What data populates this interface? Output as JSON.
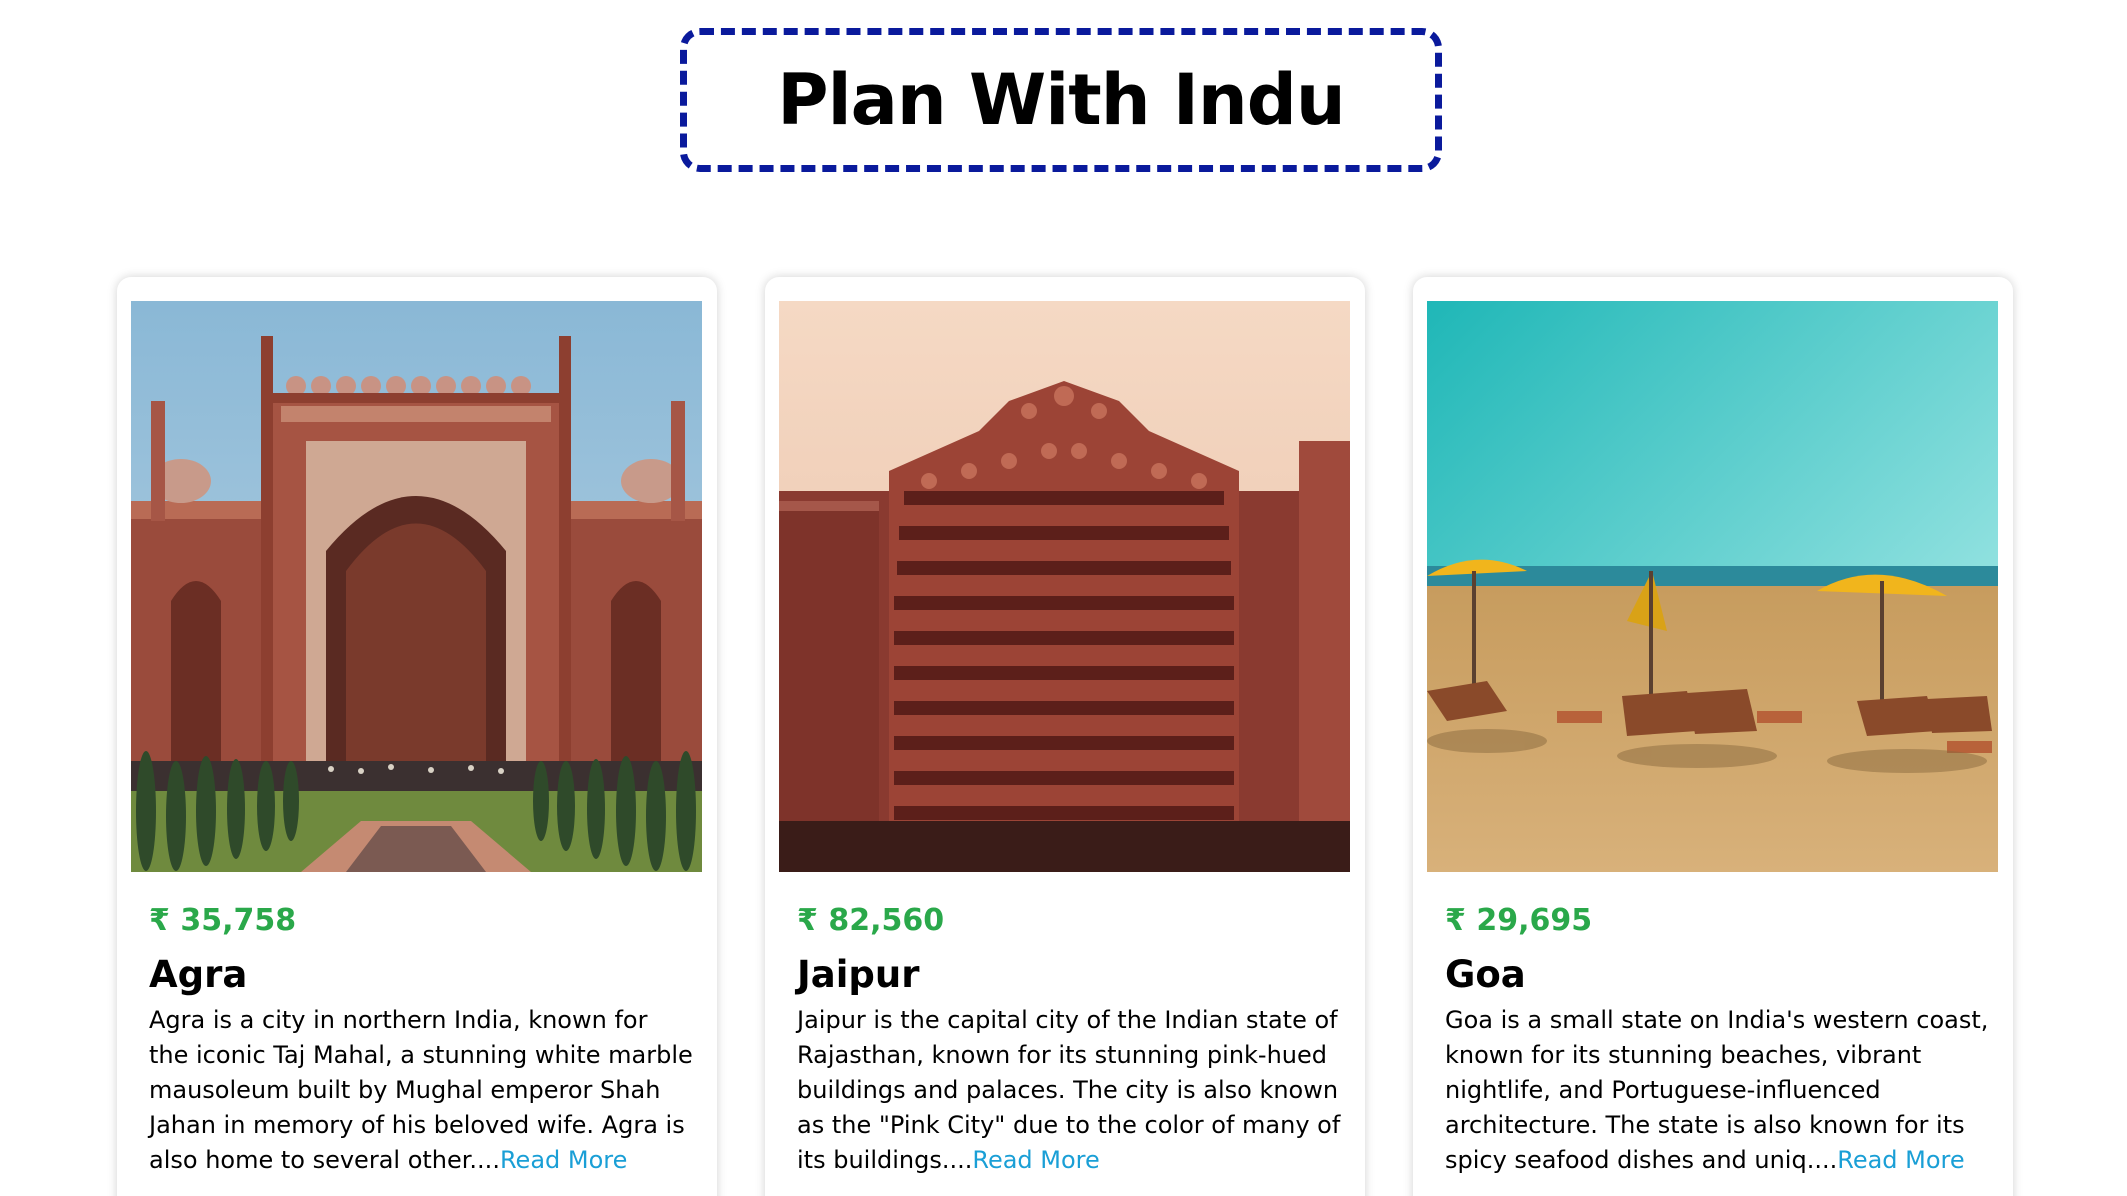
{
  "page_title": "Plan With Indu",
  "colors": {
    "title_border": "#0a1a9c",
    "price": "#2aa84a",
    "link": "#1a9fd6"
  },
  "cards": [
    {
      "price": "₹ 35,758",
      "name": "Agra",
      "description": "Agra is a city in northern India, known for the iconic Taj Mahal, a stunning white marble mausoleum built by Mughal emperor Shah Jahan in memory of his beloved wife. Agra is also home to several other....",
      "read_more": "Read More",
      "image": "taj-mahal-gate-photo"
    },
    {
      "price": "₹ 82,560",
      "name": "Jaipur",
      "description": "Jaipur is the capital city of the Indian state of Rajasthan, known for its stunning pink-hued buildings and palaces. The city is also known as the \"Pink City\" due to the color of many of its buildings....",
      "read_more": "Read More",
      "image": "hawa-mahal-photo"
    },
    {
      "price": "₹ 29,695",
      "name": "Goa",
      "description": "Goa is a small state on India's western coast, known for its stunning beaches, vibrant nightlife, and Portuguese-influenced architecture. The state is also known for its spicy seafood dishes and uniq....",
      "read_more": "Read More",
      "image": "goa-beach-photo"
    }
  ]
}
